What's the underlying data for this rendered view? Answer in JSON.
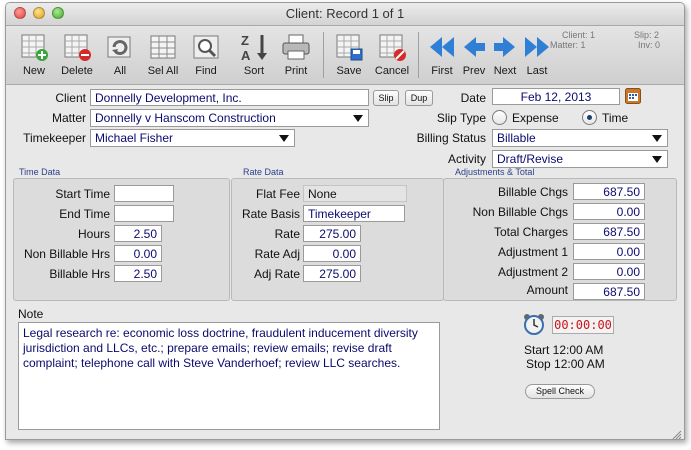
{
  "window": {
    "title": "Client: Record 1 of 1"
  },
  "toolbar": {
    "new": "New",
    "delete": "Delete",
    "all": "All",
    "sel_all": "Sel All",
    "find": "Find",
    "sort": "Sort",
    "print": "Print",
    "save": "Save",
    "cancel": "Cancel",
    "first": "First",
    "prev": "Prev",
    "next": "Next",
    "last": "Last"
  },
  "record_info": {
    "client": "Client: 1",
    "matter": "Matter: 1",
    "slip": "Slip: 2",
    "inv": "Inv: 0"
  },
  "header": {
    "client_label": "Client",
    "client_value": "Donnelly Development, Inc.",
    "slip_btn": "Slip",
    "dup_btn": "Dup",
    "date_label": "Date",
    "date_value": "Feb 12, 2013",
    "matter_label": "Matter",
    "matter_value": "Donnelly v Hanscom Construction",
    "timekeeper_label": "Timekeeper",
    "timekeeper_value": "Michael Fisher",
    "slip_type_label": "Slip Type",
    "slip_type_options": [
      "Expense",
      "Time"
    ],
    "slip_type_selected": "Time",
    "billing_status_label": "Billing Status",
    "billing_status_value": "Billable",
    "activity_label": "Activity",
    "activity_value": "Draft/Revise"
  },
  "time_data": {
    "title": "Time Data",
    "start_time_label": "Start Time",
    "start_time": "",
    "end_time_label": "End Time",
    "end_time": "",
    "hours_label": "Hours",
    "hours": "2.50",
    "non_billable_hrs_label": "Non Billable Hrs",
    "non_billable_hrs": "0.00",
    "billable_hrs_label": "Billable Hrs",
    "billable_hrs": "2.50"
  },
  "rate_data": {
    "title": "Rate Data",
    "flat_fee_label": "Flat Fee",
    "flat_fee": "None",
    "rate_basis_label": "Rate Basis",
    "rate_basis": "Timekeeper",
    "rate_label": "Rate",
    "rate": "275.00",
    "rate_adj_label": "Rate Adj",
    "rate_adj": "0.00",
    "adj_rate_label": "Adj Rate",
    "adj_rate": "275.00"
  },
  "adjustments": {
    "title": "Adjustments & Total",
    "billable_chgs_label": "Billable Chgs",
    "billable_chgs": "687.50",
    "non_billable_chgs_label": "Non Billable Chgs",
    "non_billable_chgs": "0.00",
    "total_charges_label": "Total Charges",
    "total_charges": "687.50",
    "adjustment1_label": "Adjustment 1",
    "adjustment1": "0.00",
    "adjustment2_label": "Adjustment 2",
    "adjustment2": "0.00",
    "amount_label": "Amount",
    "amount": "687.50"
  },
  "note": {
    "label": "Note",
    "text": "Legal research re: economic loss doctrine, fraudulent inducement diversity jurisdiction and LLCs, etc.; prepare emails; review emails; revise draft complaint; telephone call with Steve Vanderhoef; review LLC searches."
  },
  "timer": {
    "display": "00:00:00",
    "start": "Start 12:00 AM",
    "stop": "Stop 12:00 AM",
    "spell_check": "Spell Check"
  },
  "colors": {
    "field_text": "#0a0a6e",
    "timer_text": "#c8161d",
    "group_title": "#2a3f8a",
    "nav_arrow": "#2f7fd6"
  }
}
